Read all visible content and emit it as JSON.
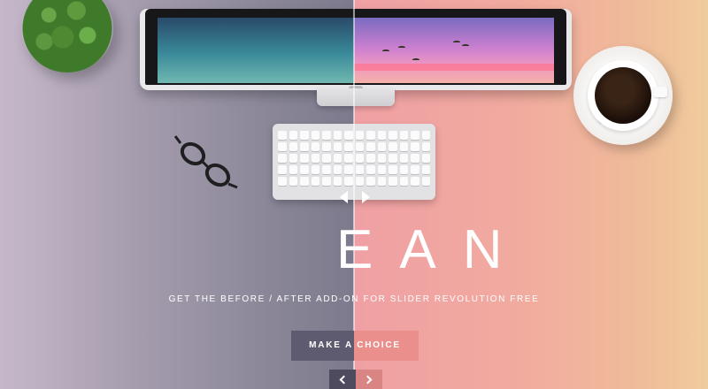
{
  "slider": {
    "headline": "EAN",
    "subtitle": "GET THE BEFORE / AFTER ADD-ON FOR SLIDER REVOLUTION FREE",
    "cta_label": "MAKE A CHOICE",
    "colors": {
      "left_tone": "#8b8799",
      "right_tone": "#f1aa9f",
      "cta_left": "#5e5a6f",
      "cta_right": "#ea8f8c"
    }
  },
  "icons": {
    "compare_handle": "left-right-arrows-icon",
    "prev": "chevron-left-icon",
    "next": "chevron-right-icon"
  }
}
